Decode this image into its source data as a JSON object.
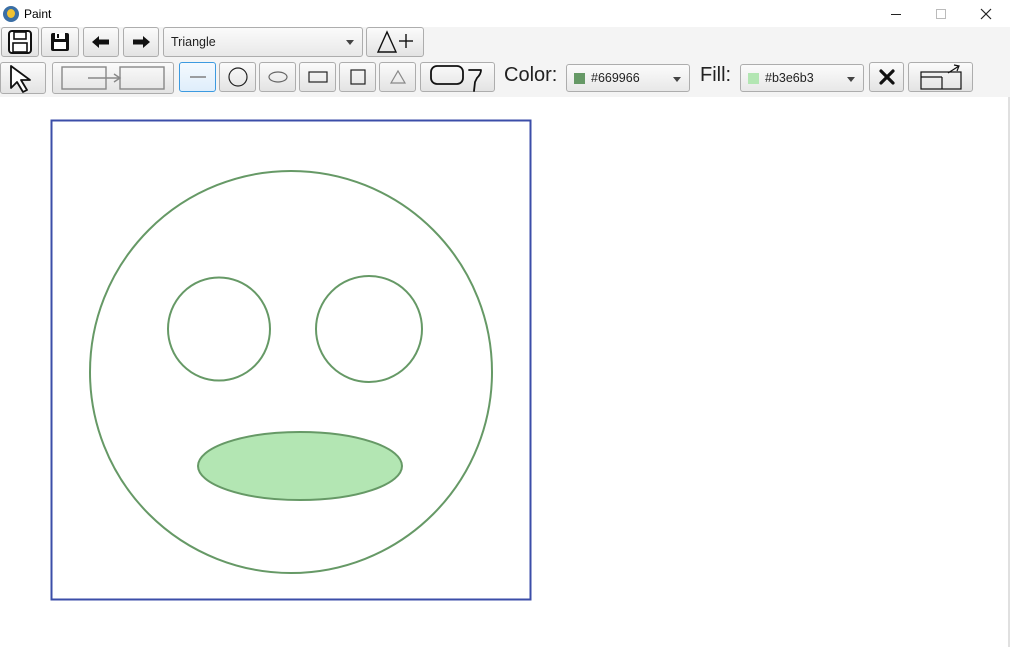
{
  "window": {
    "title": "Paint"
  },
  "toolbar_top": {
    "shape_select_value": "Triangle"
  },
  "toolbar_tools": {
    "color_label": "Color:",
    "color_value": "#669966",
    "fill_label": "Fill:",
    "fill_value": "#b3e6b3"
  },
  "colors": {
    "stroke": "#669966",
    "fill": "#b3e6b3",
    "frame": "#3b4ea8"
  }
}
